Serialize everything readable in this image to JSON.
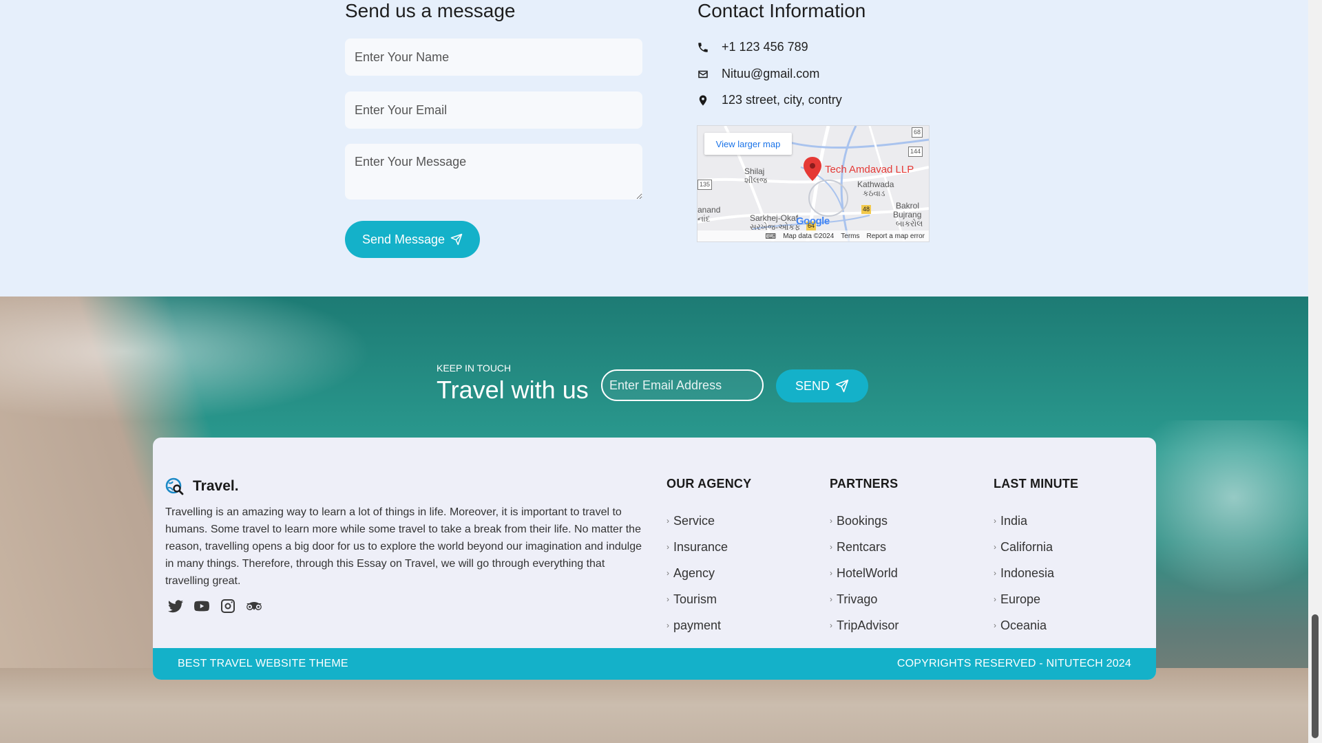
{
  "contact_form": {
    "heading": "Send us a message",
    "name_placeholder": "Enter Your Name",
    "email_placeholder": "Enter Your Email",
    "message_placeholder": "Enter Your Message",
    "send_label": "Send Message"
  },
  "contact_info": {
    "heading": "Contact Information",
    "phone": "+1 123 456 789",
    "email": "Nituu@gmail.com",
    "address": "123 street, city, contry"
  },
  "map": {
    "view_larger": "View larger map",
    "business": "Tech Amdavad LLP",
    "places": {
      "shilaj": "Shilaj",
      "shilaj_gu": "શીલજ",
      "kathwada": "Kathwada",
      "kathwada_gu": "કઠવાડ",
      "anand": "anand",
      "anand_gu": "નાંદ",
      "sarkhej": "Sarkhej-Okaf",
      "sarkhej_gu": "સરખેજ-ઓકફ",
      "bakrol": "Bakrol",
      "bujrang": "Bujrang",
      "bakrol_gu": "બાકરોલ"
    },
    "road_badges": [
      "68",
      "144",
      "135",
      "48",
      "64"
    ],
    "google_logo": "Google",
    "map_data": "Map data ©2024",
    "terms": "Terms",
    "report": "Report a map error"
  },
  "newsletter": {
    "kicker": "KEEP IN TOUCH",
    "title": "Travel with us",
    "email_placeholder": "Enter Email Address",
    "send_label": "SEND"
  },
  "footer": {
    "brand": "Travel.",
    "about": "Travelling is an amazing way to learn a lot of things in life. Moreover, it is important to travel to humans. Some travel to learn more while some travel to take a break from their life. No matter the reason, travelling opens a big door for us to explore the world beyond our imagination and indulge in many things. Therefore, through this Essay on Travel, we will go through everything that travelling great.",
    "social_icons": [
      "twitter-icon",
      "youtube-icon",
      "instagram-icon",
      "tripadvisor-icon"
    ],
    "columns": [
      {
        "heading": "OUR AGENCY",
        "links": [
          "Service",
          "Insurance",
          "Agency",
          "Tourism",
          "payment"
        ]
      },
      {
        "heading": "PARTNERS",
        "links": [
          "Bookings",
          "Rentcars",
          "HotelWorld",
          "Trivago",
          "TripAdvisor"
        ]
      },
      {
        "heading": "LAST MINUTE",
        "links": [
          "India",
          "California",
          "Indonesia",
          "Europe",
          "Oceania"
        ]
      }
    ],
    "bar_left": "BEST TRAVEL WEBSITE THEME",
    "bar_right": "COPYRIGHTS RESERVED - NITUTECH 2024"
  },
  "colors": {
    "accent": "#14b1c9",
    "contact_bg": "#e6effb",
    "card_bg": "#eeeff8"
  }
}
